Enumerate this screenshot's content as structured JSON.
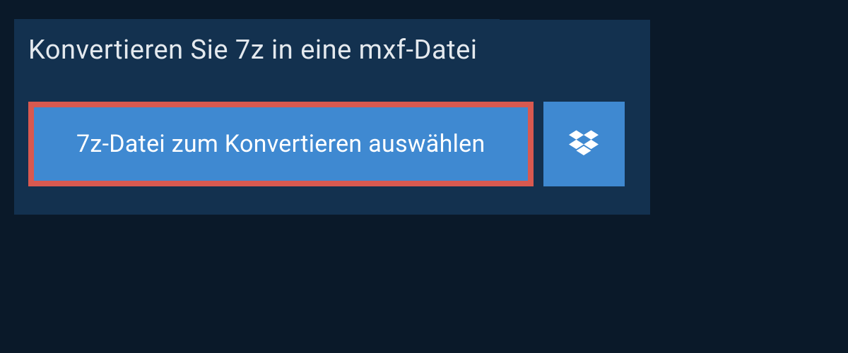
{
  "header": {
    "title": "Konvertieren Sie 7z in eine mxf-Datei"
  },
  "upload": {
    "select_file_label": "7z-Datei zum Konvertieren auswählen"
  },
  "colors": {
    "background": "#0a1929",
    "panel": "#13314f",
    "button_primary": "#3f89d1",
    "highlight_border": "#d85950"
  }
}
